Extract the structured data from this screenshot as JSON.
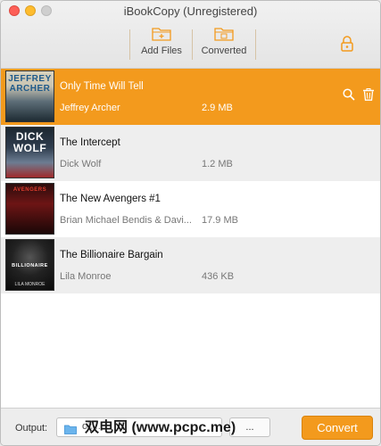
{
  "window": {
    "title": "iBookCopy (Unregistered)"
  },
  "toolbar": {
    "add_files_label": "Add Files",
    "converted_label": "Converted"
  },
  "books": [
    {
      "title": "Only Time Will Tell",
      "author": "Jeffrey Archer",
      "size": "2.9 MB",
      "cover_line1": "JEFFREY",
      "cover_line2": "ARCHER",
      "selected": true
    },
    {
      "title": "The Intercept",
      "author": "Dick Wolf",
      "size": "1.2 MB",
      "cover_line1": "DICK",
      "cover_line2": "WOLF",
      "selected": false
    },
    {
      "title": "The New Avengers #1",
      "author": "Brian Michael Bendis & Davi...",
      "size": "17.9 MB",
      "cover_line1": "AVENGERS",
      "cover_line2": "",
      "selected": false
    },
    {
      "title": "The Billionaire Bargain",
      "author": "Lila Monroe",
      "size": "436 KB",
      "cover_line1": "BILLIONAIRE",
      "cover_line2": "LILA MONROE",
      "selected": false
    }
  ],
  "footer": {
    "output_label": "Output:",
    "path_text": "ok...",
    "browse_label": "...",
    "convert_label": "Convert",
    "watermark": "双电网 (www.pcpc.me)"
  },
  "colors": {
    "accent": "#f39a1d",
    "selected_row": "#f39a1d",
    "alt_row": "#eeeeee"
  },
  "icons": [
    "folder-add-icon",
    "folder-converted-icon",
    "lock-icon",
    "search-icon",
    "trash-icon",
    "folder-icon"
  ]
}
